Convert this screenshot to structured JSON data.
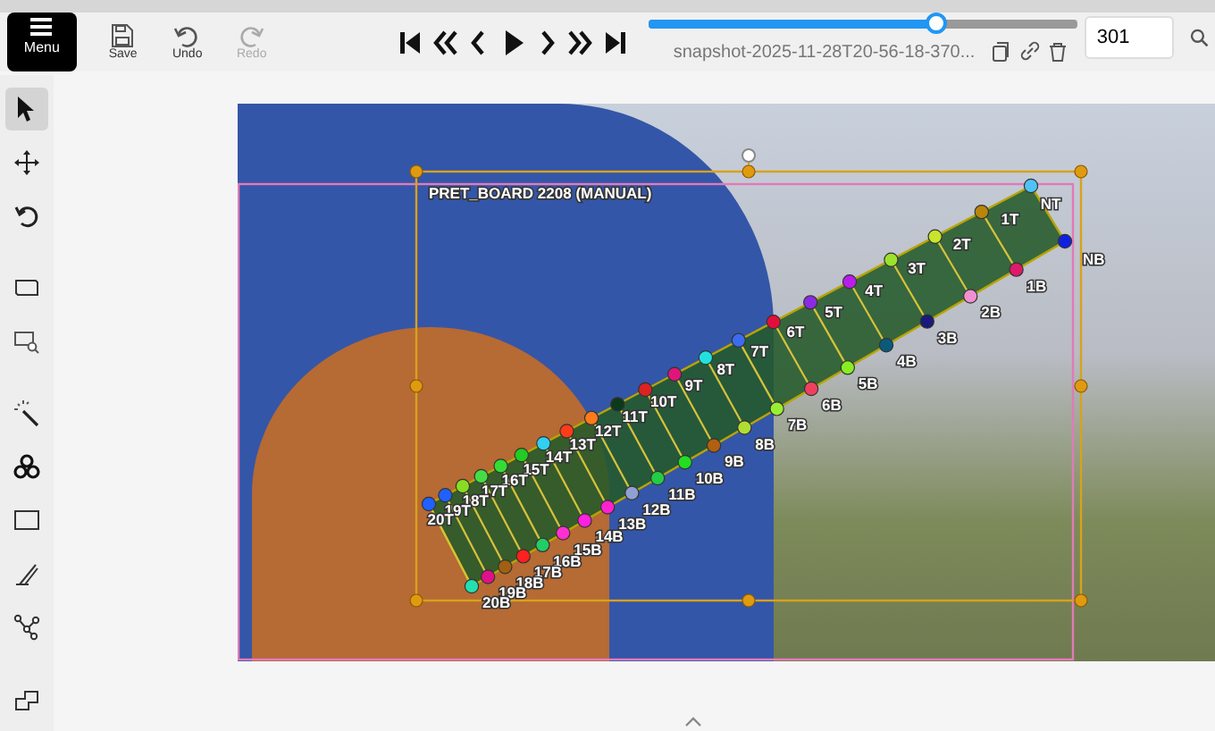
{
  "toolbar": {
    "menu": "Menu",
    "actions": [
      {
        "kind": "save",
        "label": "Save",
        "disabled": false
      },
      {
        "kind": "undo",
        "label": "Undo",
        "disabled": false
      },
      {
        "kind": "redo",
        "label": "Redo",
        "disabled": true
      }
    ],
    "timeline": {
      "level": 0.67
    },
    "filename": "snapshot-2025-11-28T20-56-18-370...",
    "frame": "301"
  },
  "tool_groups": [
    [
      {
        "kind": "cursor",
        "selected": true
      },
      {
        "kind": "move",
        "selected": false
      },
      {
        "kind": "rotate",
        "selected": false
      }
    ],
    [
      {
        "kind": "box",
        "selected": false
      },
      {
        "kind": "box-zoom",
        "selected": false
      }
    ],
    [
      {
        "kind": "wand",
        "selected": false
      },
      {
        "kind": "trefoil",
        "selected": false
      },
      {
        "kind": "rect",
        "selected": false
      },
      {
        "kind": "brush",
        "selected": false
      },
      {
        "kind": "graph",
        "selected": false
      }
    ],
    [
      {
        "kind": "layers",
        "selected": false
      }
    ]
  ],
  "annotation": {
    "label": "PRET_BOARD 2208 (MANUAL)",
    "top_points": [
      {
        "label": "NT",
        "color": "#4fc3f7"
      },
      {
        "label": "1T",
        "color": "#b8860b"
      },
      {
        "label": "2T",
        "color": "#c6e52b"
      },
      {
        "label": "3T",
        "color": "#9be22d"
      },
      {
        "label": "4T",
        "color": "#b81ee8"
      },
      {
        "label": "5T",
        "color": "#8a2be2"
      },
      {
        "label": "6T",
        "color": "#e0103a"
      },
      {
        "label": "7T",
        "color": "#3b6cf0"
      },
      {
        "label": "8T",
        "color": "#22e0e0"
      },
      {
        "label": "9T",
        "color": "#e0157a"
      },
      {
        "label": "10T",
        "color": "#dd2222"
      },
      {
        "label": "11T",
        "color": "#0a3a1a"
      },
      {
        "label": "12T",
        "color": "#ff7a1a"
      },
      {
        "label": "13T",
        "color": "#ff3b1a"
      },
      {
        "label": "14T",
        "color": "#30d0f0"
      },
      {
        "label": "15T",
        "color": "#22cc22"
      },
      {
        "label": "16T",
        "color": "#33dd33"
      },
      {
        "label": "17T",
        "color": "#44dd44"
      },
      {
        "label": "18T",
        "color": "#88dd22"
      },
      {
        "label": "19T",
        "color": "#2060ff"
      },
      {
        "label": "20T",
        "color": "#2060ff"
      }
    ],
    "bottom_points": [
      {
        "label": "NB",
        "color": "#1020e0"
      },
      {
        "label": "1B",
        "color": "#e01a6a"
      },
      {
        "label": "2B",
        "color": "#f090d0"
      },
      {
        "label": "3B",
        "color": "#1a1a7a"
      },
      {
        "label": "4B",
        "color": "#0a5a7a"
      },
      {
        "label": "5B",
        "color": "#88ee22"
      },
      {
        "label": "6B",
        "color": "#f04060"
      },
      {
        "label": "7B",
        "color": "#99ee33"
      },
      {
        "label": "8B",
        "color": "#b0dd33"
      },
      {
        "label": "9B",
        "color": "#b06010"
      },
      {
        "label": "10B",
        "color": "#22dd22"
      },
      {
        "label": "11B",
        "color": "#22cc44"
      },
      {
        "label": "12B",
        "color": "#90a0d0"
      },
      {
        "label": "13B",
        "color": "#ff20d0"
      },
      {
        "label": "14B",
        "color": "#ff20e0"
      },
      {
        "label": "15B",
        "color": "#ff30d0"
      },
      {
        "label": "16B",
        "color": "#22cc66"
      },
      {
        "label": "17B",
        "color": "#ff2020"
      },
      {
        "label": "18B",
        "color": "#a06010"
      },
      {
        "label": "19B",
        "color": "#e0108a"
      },
      {
        "label": "20B",
        "color": "#22e0b0"
      }
    ]
  }
}
